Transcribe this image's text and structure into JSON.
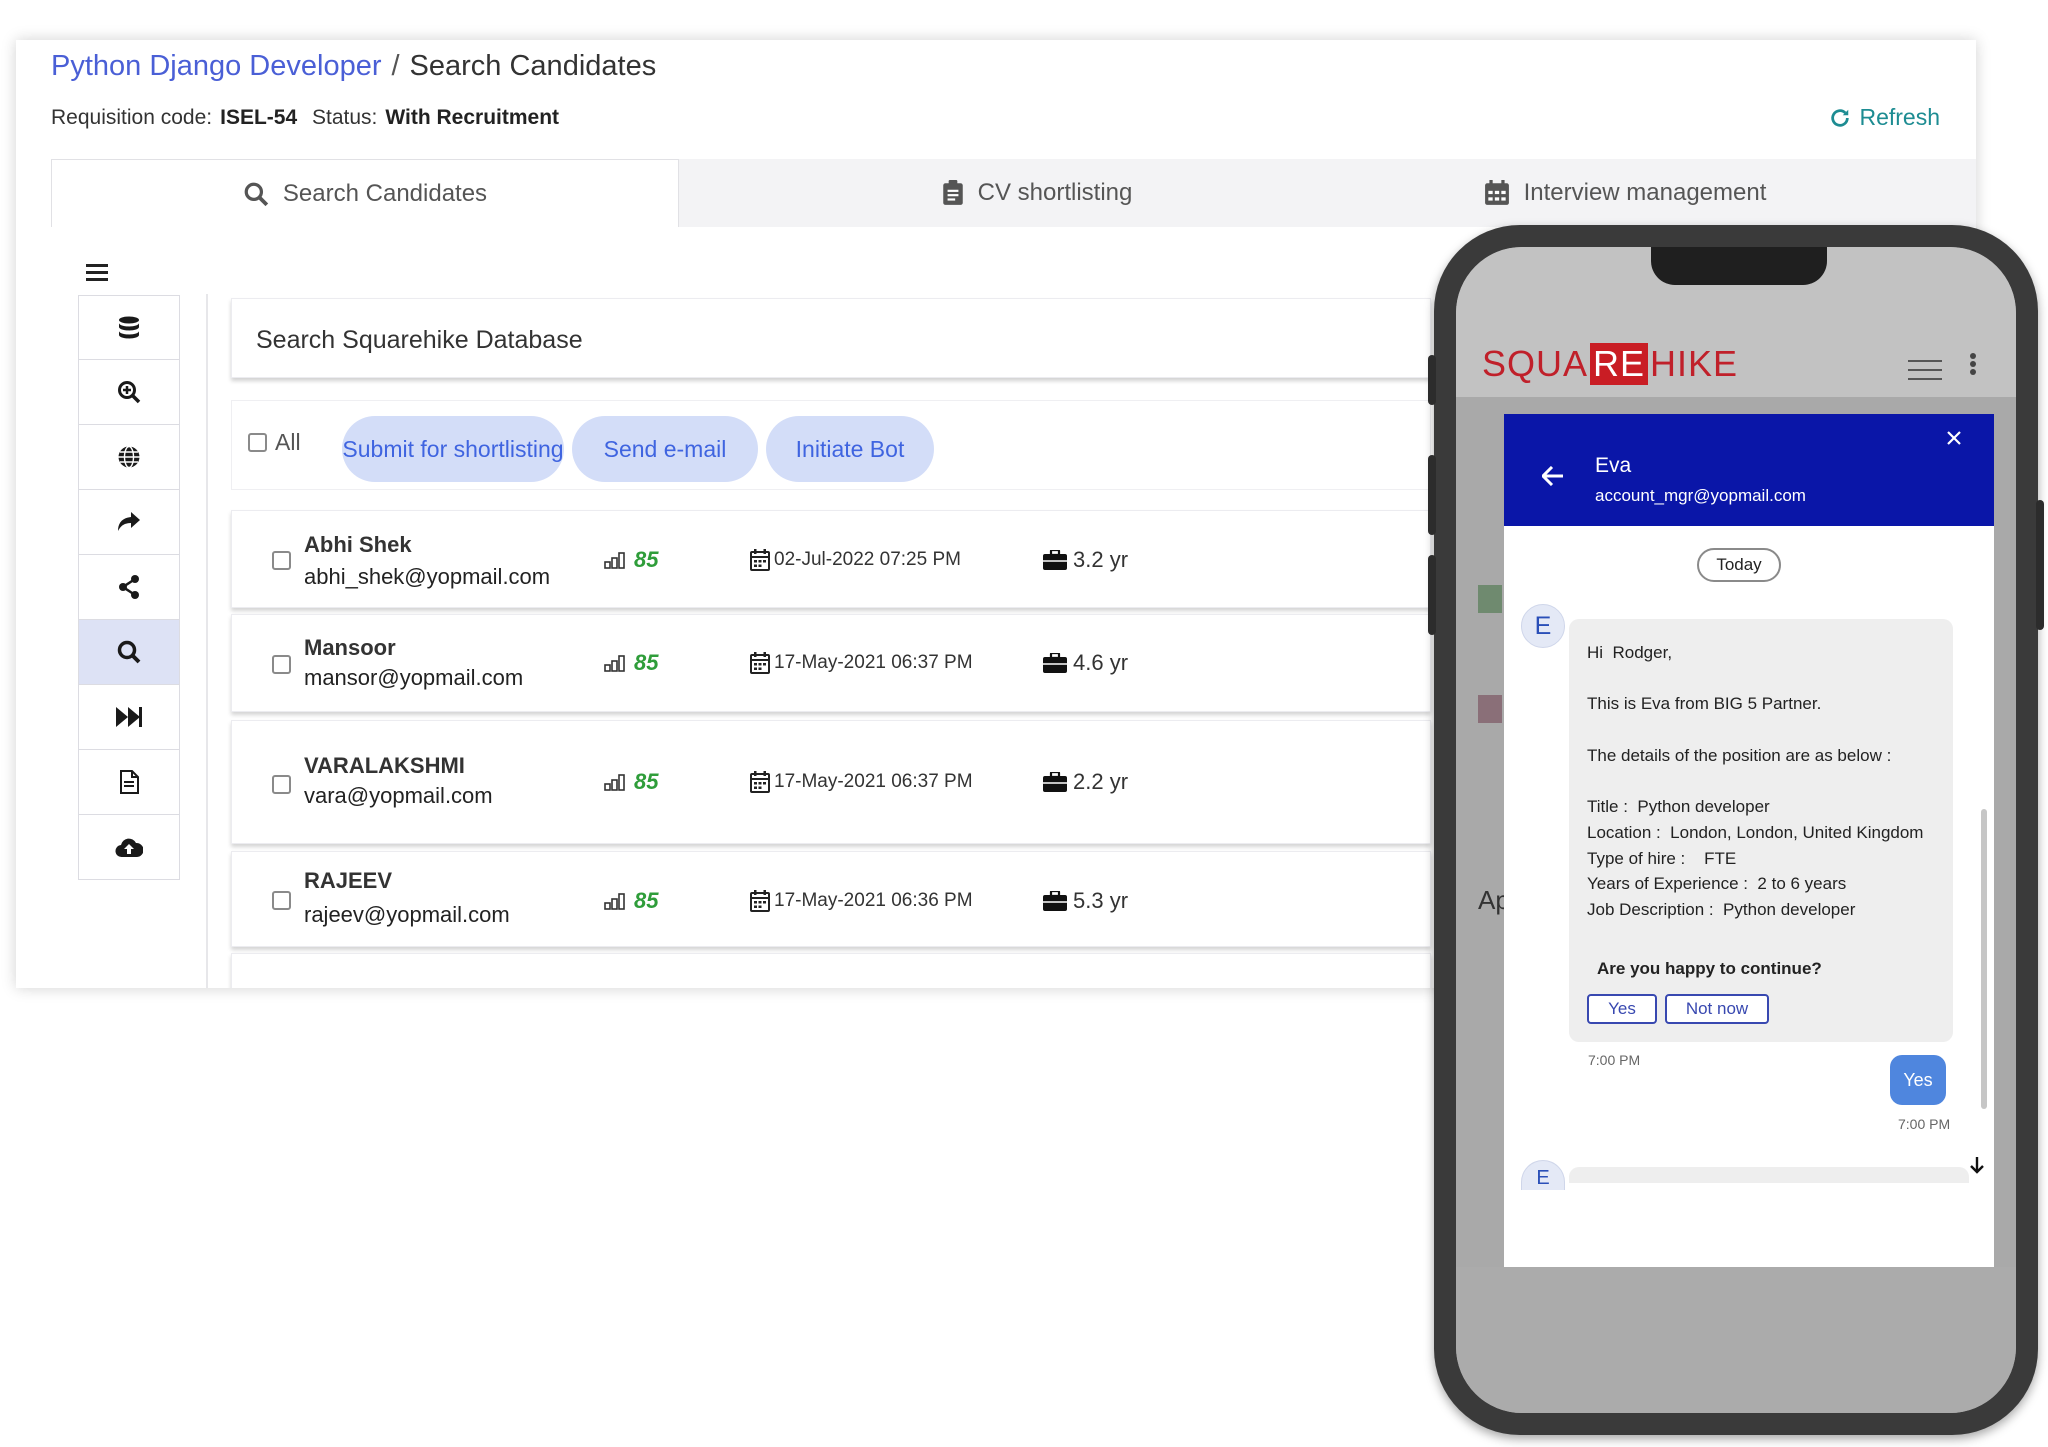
{
  "breadcrumb": {
    "parent": "Python Django Developer",
    "separator": "/",
    "current": "Search Candidates"
  },
  "requisition": {
    "code_label": "Requisition code:",
    "code_value": "ISEL-54",
    "status_label": "Status:",
    "status_value": "With Recruitment"
  },
  "refresh_label": "Refresh",
  "tabs": [
    {
      "label": "Search Candidates",
      "icon": "search-icon",
      "active": true
    },
    {
      "label": "CV shortlisting",
      "icon": "clipboard-icon",
      "active": false
    },
    {
      "label": "Interview management",
      "icon": "calendar-icon",
      "active": false
    }
  ],
  "sidebar_icons": [
    "database-icon",
    "zoom-in-icon",
    "globe-icon",
    "share-arrow-icon",
    "share-nodes-icon",
    "search-icon",
    "fast-forward-icon",
    "document-icon",
    "cloud-upload-icon"
  ],
  "search": {
    "placeholder": "Search Squarehike Database"
  },
  "actions": {
    "all_label": "All",
    "submit": "Submit for shortlisting",
    "email": "Send e-mail",
    "bot": "Initiate Bot"
  },
  "candidates": [
    {
      "name": "Abhi Shek",
      "email": "abhi_shek@yopmail.com",
      "score": "85",
      "date": "02-Jul-2022 07:25 PM",
      "experience": "3.2 yr"
    },
    {
      "name": "Mansoor",
      "email": "mansor@yopmail.com",
      "score": "85",
      "date": "17-May-2021 06:37 PM",
      "experience": "4.6 yr"
    },
    {
      "name": "VARALAKSHMI",
      "email": "vara@yopmail.com",
      "score": "85",
      "date": "17-May-2021 06:37 PM",
      "experience": "2.2 yr"
    },
    {
      "name": "RAJEEV",
      "email": "rajeev@yopmail.com",
      "score": "85",
      "date": "17-May-2021 06:36 PM",
      "experience": "5.3 yr"
    }
  ],
  "phone": {
    "logo": {
      "left": "SQUA",
      "box": "RE",
      "right": "HIKE"
    },
    "background_fragment": "Ap",
    "chat": {
      "name": "Eva",
      "email": "account_mgr@yopmail.com",
      "day": "Today",
      "avatar_letter": "E",
      "message_lines": [
        "Hi  Rodger,",
        "This is Eva from BIG 5 Partner.",
        "The details of the position are as below :",
        "Title :  Python developer",
        "Location :  London, London, United Kingdom",
        "Type of hire :    FTE",
        "Years of Experience :  2 to 6 years",
        "Job Description :  Python developer"
      ],
      "question": "Are you happy to continue?",
      "yes_label": "Yes",
      "not_now_label": "Not now",
      "incoming_time": "7:00 PM",
      "reply": "Yes",
      "reply_time": "7:00 PM"
    }
  },
  "colors": {
    "link_blue": "#4a5fd6",
    "refresh_teal": "#1d8c92",
    "pill_bg": "#d3ddf8",
    "pill_text": "#3f64e0",
    "score_green": "#2f9d3a",
    "chat_header": "#0a16a8",
    "brand_red": "#c91d24"
  }
}
